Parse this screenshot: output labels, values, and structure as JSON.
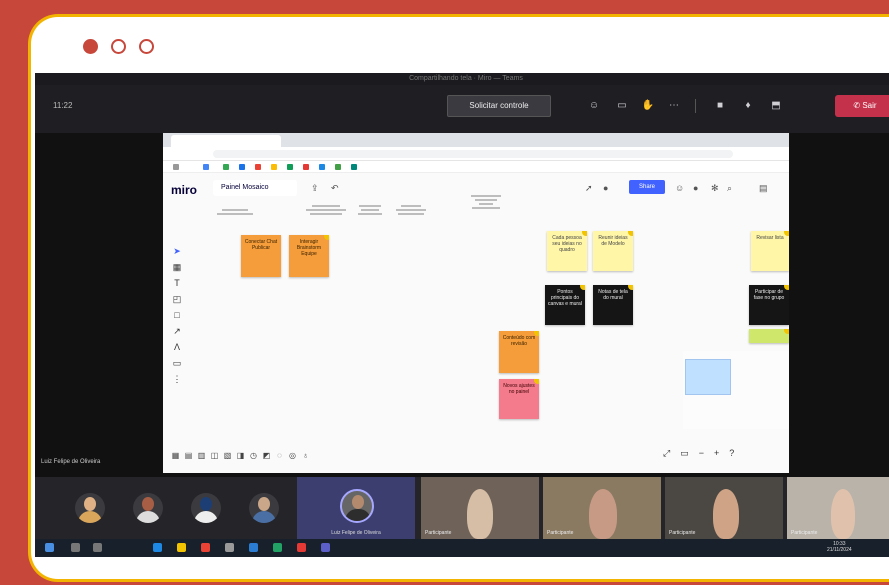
{
  "window": {
    "title": "Compartilhando tela · Miro — Teams"
  },
  "teams": {
    "time": "11:22",
    "control_button": "Solicitar controle",
    "leave_button": "Sair"
  },
  "miro": {
    "logo": "miro",
    "board_name": "Painel Mosaico",
    "share_label": "Share"
  },
  "stickies": {
    "orange1": "Conectar Chat Publicar",
    "orange2": "Interagir Brainstorm Equipe",
    "yellow1": "Cada pessoa seu ideias no quadro",
    "yellow2": "Reunir ideias de Modelo",
    "black1": "Pontos principais do canvas e mural",
    "black2": "Notas de tela do mural",
    "black3": "Participar de fase no grupo",
    "orange3": "Conteúdo com revisão",
    "pink1": "Novos ajustes no painel",
    "yellow3": "Revisar lista"
  },
  "presenter": {
    "name": "Luiz Felipe de Oliveira"
  },
  "participants": {
    "speaker_name": "Luiz Felipe de Oliveira",
    "video_names": [
      "Participante",
      "Participante",
      "Participante",
      "Participante"
    ]
  },
  "taskbar": {
    "time": "10:33",
    "date": "21/11/2024"
  },
  "colors": {
    "background": "#c8473b",
    "frame_border": "#f2b400",
    "teams_leave": "#c4314b",
    "miro_share": "#4262ff"
  }
}
